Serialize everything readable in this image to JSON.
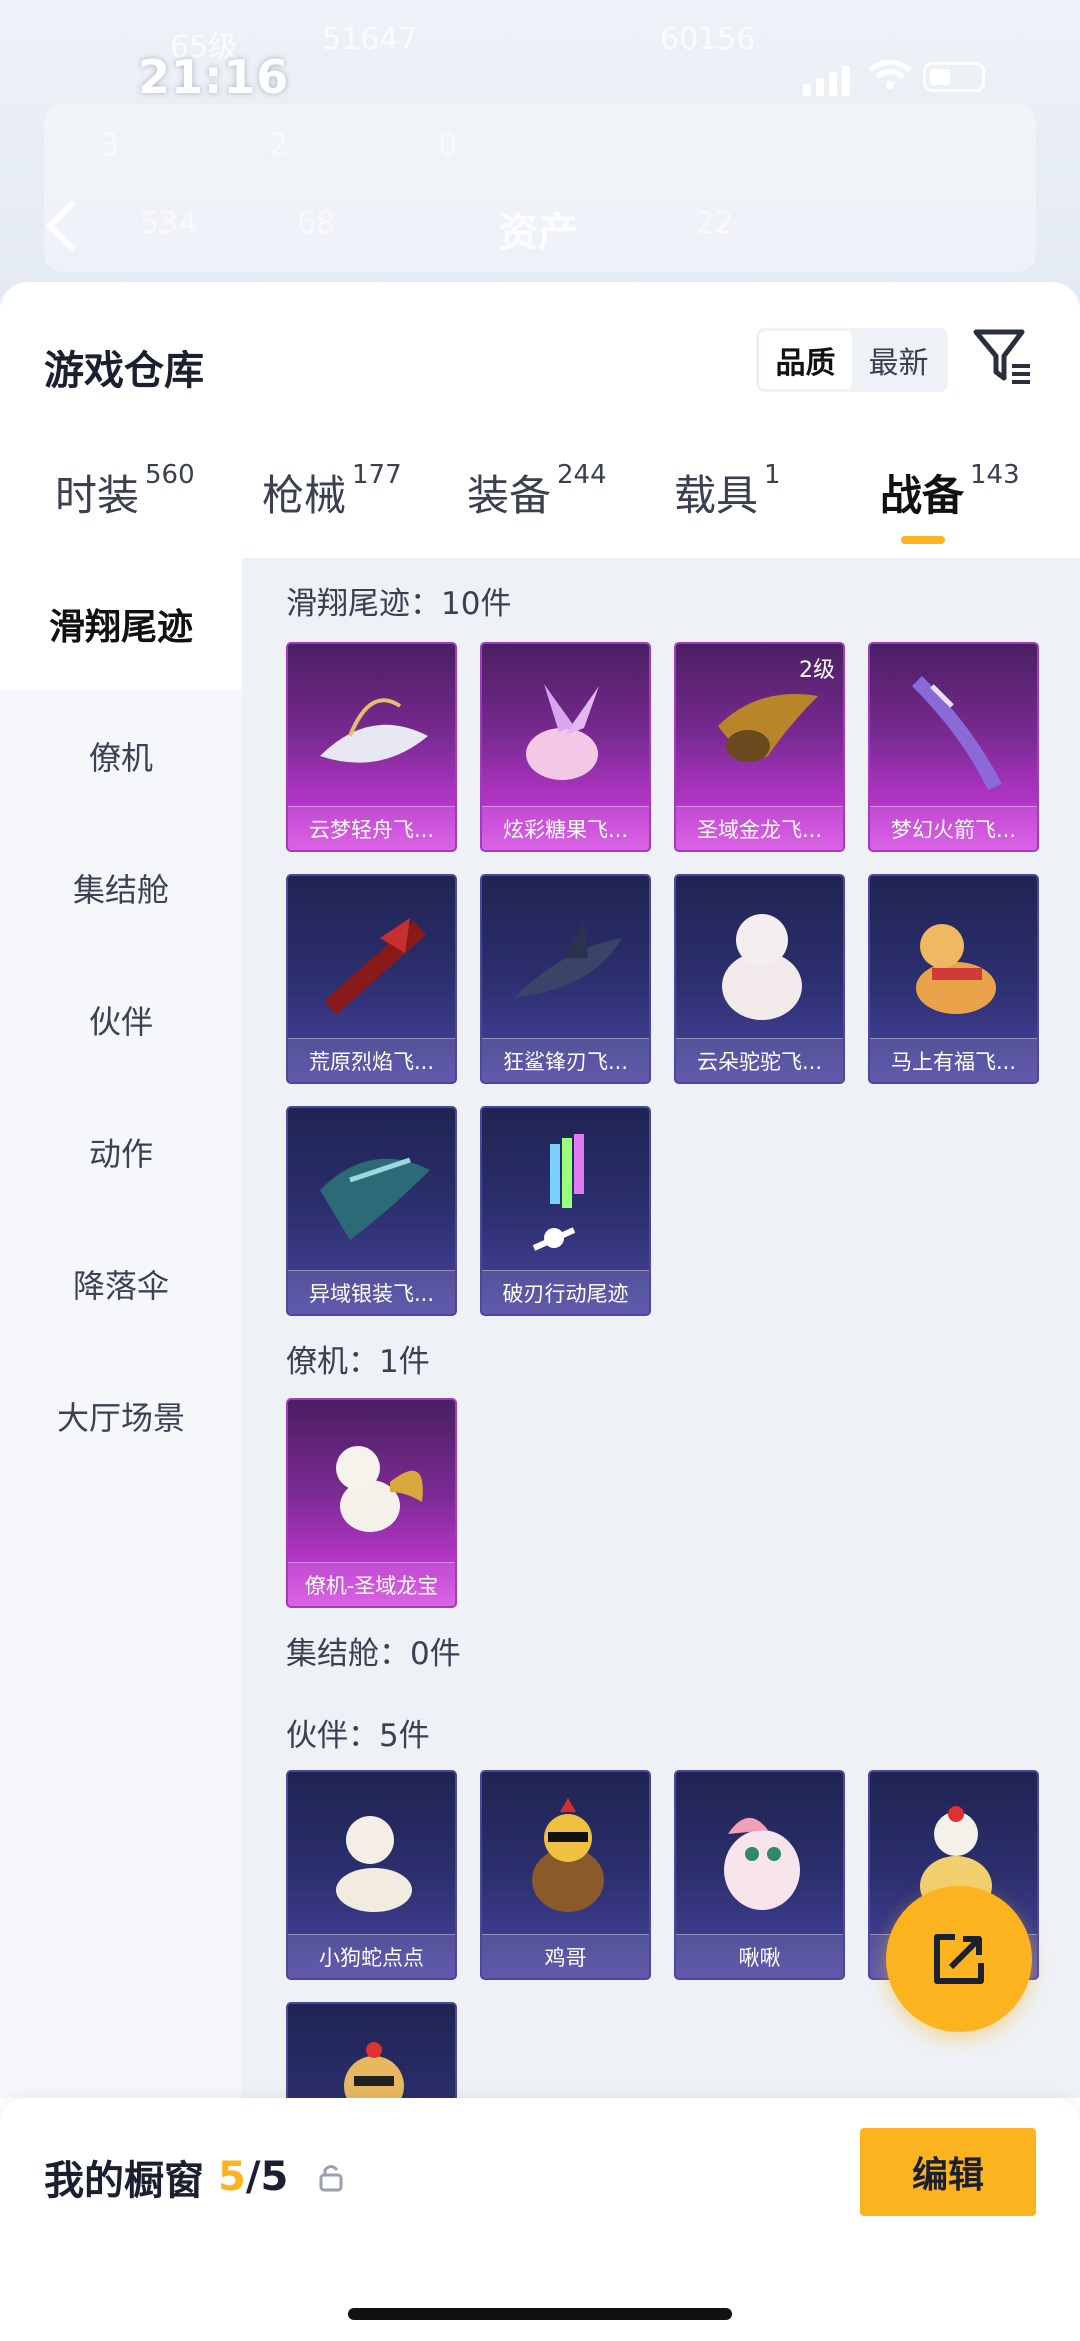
{
  "status": {
    "time": "21:16",
    "level_text": "65级",
    "id_text": "51647",
    "score_text": "60156"
  },
  "header_blur": {
    "title": "资产",
    "row1": [
      "3",
      "2",
      "0"
    ],
    "row2": [
      "534",
      "68",
      "22"
    ]
  },
  "sheet": {
    "title": "游戏仓库",
    "sort_options": [
      "品质",
      "最新"
    ]
  },
  "tabs": [
    {
      "label": "时装",
      "count": "560"
    },
    {
      "label": "枪械",
      "count": "177"
    },
    {
      "label": "装备",
      "count": "244"
    },
    {
      "label": "载具",
      "count": "1"
    },
    {
      "label": "战备",
      "count": "143"
    }
  ],
  "sidebar": [
    "滑翔尾迹",
    "僚机",
    "集结舱",
    "伙伴",
    "动作",
    "降落伞",
    "大厅场景"
  ],
  "sections": {
    "glide": {
      "title": "滑翔尾迹：10件",
      "items": [
        "云梦轻舟飞...",
        "炫彩糖果飞...",
        "圣域金龙飞...",
        "梦幻火箭飞...",
        "荒原烈焰飞...",
        "狂鲨锋刃飞...",
        "云朵驼驼飞...",
        "马上有福飞...",
        "异域银装飞...",
        "破刃行动尾迹"
      ],
      "level_badge": "2级"
    },
    "wingman": {
      "title": "僚机：1件",
      "items": [
        "僚机-圣域龙宝"
      ]
    },
    "capsule": {
      "title": "集结舱：0件"
    },
    "partner": {
      "title": "伙伴：5件",
      "items": [
        "小狗蛇点点",
        "鸡哥",
        "啾啾"
      ]
    }
  },
  "bottom": {
    "label": "我的橱窗",
    "current": "5",
    "max": "/5",
    "edit": "编辑"
  },
  "colors": {
    "accent": "#fbb320",
    "purple_card": "#c238d4",
    "blue_card": "#4a44a2"
  },
  "icons": [
    "filter-icon",
    "share-icon",
    "lock-icon",
    "back-icon"
  ]
}
